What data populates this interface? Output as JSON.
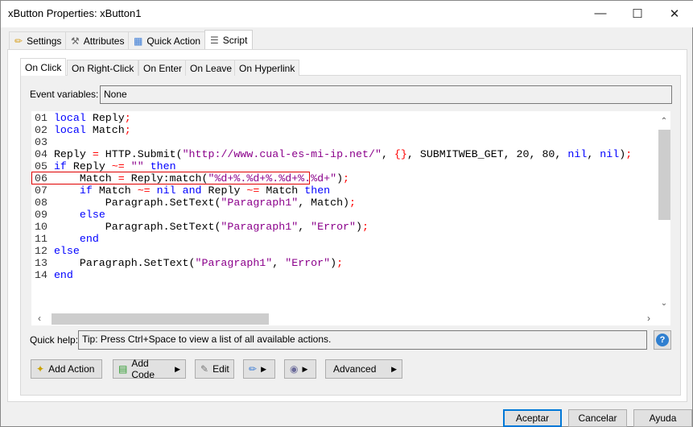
{
  "window": {
    "title": "xButton Properties: xButton1"
  },
  "tabs": [
    {
      "label": "Settings",
      "icon": "pencil-icon"
    },
    {
      "label": "Attributes",
      "icon": "tools-icon"
    },
    {
      "label": "Quick Action",
      "icon": "flowchart-icon"
    },
    {
      "label": "Script",
      "icon": "script-icon",
      "active": true
    }
  ],
  "subtabs": [
    {
      "label": "On Click",
      "active": true
    },
    {
      "label": "On Right-Click"
    },
    {
      "label": "On Enter"
    },
    {
      "label": "On Leave"
    },
    {
      "label": "On Hyperlink"
    }
  ],
  "event_variables": {
    "label": "Event variables:",
    "value": "None"
  },
  "code": [
    {
      "n": "01",
      "tokens": [
        [
          "kw",
          "local"
        ],
        [
          "id",
          " Reply"
        ],
        [
          "op",
          ";"
        ]
      ]
    },
    {
      "n": "02",
      "tokens": [
        [
          "kw",
          "local"
        ],
        [
          "id",
          " Match"
        ],
        [
          "op",
          ";"
        ]
      ]
    },
    {
      "n": "03",
      "tokens": []
    },
    {
      "n": "04",
      "tokens": [
        [
          "id",
          "Reply "
        ],
        [
          "op",
          "="
        ],
        [
          "id",
          " HTTP.Submit("
        ],
        [
          "str",
          "\"http://www.cual-es-mi-ip.net/\""
        ],
        [
          "id",
          ", "
        ],
        [
          "op",
          "{}"
        ],
        [
          "id",
          ", SUBMITWEB_GET, 20, 80, "
        ],
        [
          "kw",
          "nil"
        ],
        [
          "id",
          ", "
        ],
        [
          "kw",
          "nil"
        ],
        [
          "id",
          ")"
        ],
        [
          "op",
          ";"
        ]
      ]
    },
    {
      "n": "05",
      "tokens": [
        [
          "kw",
          "if"
        ],
        [
          "id",
          " Reply "
        ],
        [
          "op",
          "~="
        ],
        [
          "id",
          " "
        ],
        [
          "str",
          "\"\""
        ],
        [
          "id",
          " "
        ],
        [
          "kw",
          "then"
        ]
      ]
    },
    {
      "n": "06",
      "tokens": [
        [
          "id",
          "    Match "
        ],
        [
          "op",
          "="
        ],
        [
          "id",
          " Reply:match("
        ],
        [
          "str",
          "\"%d+%.%d+%.%d+%.%d+\""
        ],
        [
          "id",
          ")"
        ],
        [
          "op",
          ";"
        ]
      ],
      "highlighted": true
    },
    {
      "n": "07",
      "tokens": [
        [
          "id",
          "    "
        ],
        [
          "kw",
          "if"
        ],
        [
          "id",
          " Match "
        ],
        [
          "op",
          "~="
        ],
        [
          "id",
          " "
        ],
        [
          "kw",
          "nil"
        ],
        [
          "id",
          " "
        ],
        [
          "kw",
          "and"
        ],
        [
          "id",
          " Reply "
        ],
        [
          "op",
          "~="
        ],
        [
          "id",
          " Match "
        ],
        [
          "kw",
          "then"
        ]
      ]
    },
    {
      "n": "08",
      "tokens": [
        [
          "id",
          "        Paragraph.SetText("
        ],
        [
          "str",
          "\"Paragraph1\""
        ],
        [
          "id",
          ", Match)"
        ],
        [
          "op",
          ";"
        ]
      ]
    },
    {
      "n": "09",
      "tokens": [
        [
          "id",
          "    "
        ],
        [
          "kw",
          "else"
        ]
      ]
    },
    {
      "n": "10",
      "tokens": [
        [
          "id",
          "        Paragraph.SetText("
        ],
        [
          "str",
          "\"Paragraph1\""
        ],
        [
          "id",
          ", "
        ],
        [
          "str",
          "\"Error\""
        ],
        [
          "id",
          ")"
        ],
        [
          "op",
          ";"
        ]
      ]
    },
    {
      "n": "11",
      "tokens": [
        [
          "id",
          "    "
        ],
        [
          "kw",
          "end"
        ]
      ]
    },
    {
      "n": "12",
      "tokens": [
        [
          "kw",
          "else"
        ]
      ]
    },
    {
      "n": "13",
      "tokens": [
        [
          "id",
          "    Paragraph.SetText("
        ],
        [
          "str",
          "\"Paragraph1\""
        ],
        [
          "id",
          ", "
        ],
        [
          "str",
          "\"Error\""
        ],
        [
          "id",
          ")"
        ],
        [
          "op",
          ";"
        ]
      ]
    },
    {
      "n": "14",
      "tokens": [
        [
          "kw",
          "end"
        ]
      ]
    }
  ],
  "quick_help": {
    "label": "Quick help:",
    "value": "Tip: Press Ctrl+Space to view a list of all available actions."
  },
  "toolbar": {
    "add_action": "Add Action",
    "add_code": "Add Code",
    "edit": "Edit",
    "advanced": "Advanced"
  },
  "dialog": {
    "ok": "Aceptar",
    "cancel": "Cancelar",
    "help": "Ayuda"
  },
  "colors": {
    "keyword": "#0000ff",
    "string": "#8b008b",
    "operator": "#ff0000",
    "highlight_border": "#e00000",
    "default_button_border": "#0078d7"
  }
}
